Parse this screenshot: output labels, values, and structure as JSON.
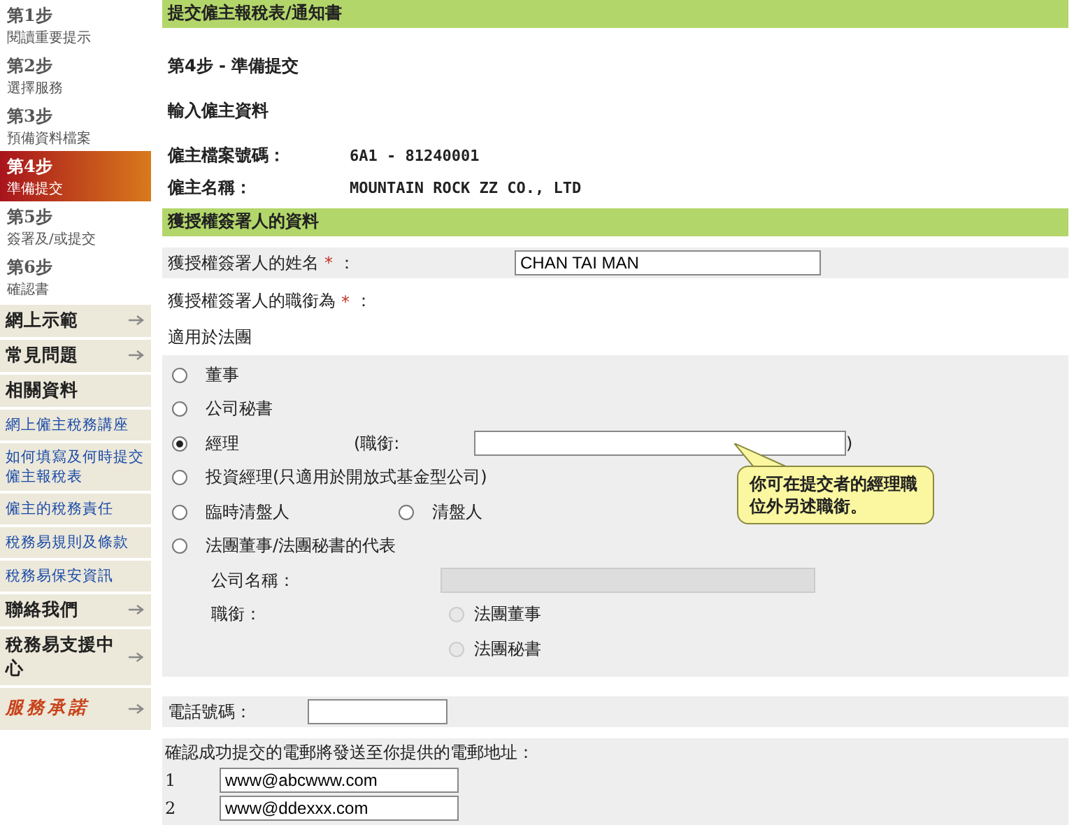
{
  "sidebar": {
    "steps": [
      {
        "step": "第1步",
        "label": "閱讀重要提示",
        "selected": false
      },
      {
        "step": "第2步",
        "label": "選擇服務",
        "selected": false
      },
      {
        "step": "第3步",
        "label": "預備資料檔案",
        "selected": false
      },
      {
        "step": "第4步",
        "label": "準備提交",
        "selected": true
      },
      {
        "step": "第5步",
        "label": "簽署及/或提交",
        "selected": false
      },
      {
        "step": "第6步",
        "label": "確認書",
        "selected": false
      }
    ],
    "menu": [
      {
        "kind": "menu",
        "label": "網上示範"
      },
      {
        "kind": "menu",
        "label": "常見問題"
      },
      {
        "kind": "heading",
        "label": "相關資料"
      },
      {
        "kind": "link",
        "label": "網上僱主稅務講座"
      },
      {
        "kind": "link",
        "label": "如何填寫及何時提交僱主報稅表"
      },
      {
        "kind": "link",
        "label": "僱主的稅務責任"
      },
      {
        "kind": "link",
        "label": "稅務易規則及條款"
      },
      {
        "kind": "link",
        "label": "稅務易保安資訊"
      },
      {
        "kind": "menu",
        "label": "聯絡我們"
      },
      {
        "kind": "menu",
        "label": "稅務易支援中心"
      },
      {
        "kind": "logo",
        "label": "服務承諾"
      }
    ]
  },
  "page_title": "提交僱主報稅表/通知書",
  "step_title": "第4步 - 準備提交",
  "employer_heading": "輸入僱主資料",
  "employer_fields": [
    {
      "label": "僱主檔案號碼：",
      "value": "6A1 - 81240001"
    },
    {
      "label": "僱主名稱：",
      "value": "MOUNTAIN ROCK ZZ CO., LTD"
    }
  ],
  "signer_section": "獲授權簽署人的資料",
  "signer_name": {
    "label": "獲授權簽署人的姓名",
    "required": "*",
    "colon": "：",
    "value": "CHAN TAI MAN"
  },
  "signer_title": {
    "label": "獲授權簽署人的職銜為",
    "required": "*",
    "colon": "："
  },
  "corporation_heading": "適用於法團",
  "options": [
    {
      "kind": "plain",
      "choices": [
        {
          "label": "董事",
          "selected": false
        }
      ]
    },
    {
      "kind": "plain",
      "choices": [
        {
          "label": "公司秘書",
          "selected": false
        }
      ]
    },
    {
      "kind": "title_field",
      "choices": [
        {
          "label": "經理",
          "selected": true
        }
      ],
      "field_label": "(職銜:",
      "field_close": ")"
    },
    {
      "kind": "plain",
      "choices": [
        {
          "label": "投資經理(只適用於開放式基金型公司)",
          "selected": false
        }
      ]
    },
    {
      "kind": "plain",
      "choices": [
        {
          "label": "臨時清盤人",
          "selected": false
        },
        {
          "label": "清盤人",
          "selected": false
        }
      ]
    },
    {
      "kind": "representative",
      "choices": [
        {
          "label": "法團董事/法團秘書的代表",
          "selected": false
        }
      ],
      "company_label": "公司名稱：",
      "title_label": "職銜：",
      "sub_choices": [
        {
          "label": "法團董事",
          "selected": false
        },
        {
          "label": "法團秘書",
          "selected": false
        }
      ]
    }
  ],
  "callout": "你可在提交者的經理職位外另述職銜。",
  "phone": {
    "label": "電話號碼："
  },
  "email": {
    "intro": "確認成功提交的電郵將發送至你提供的電郵地址：",
    "entries": [
      {
        "index": "1",
        "value": "www@abcwww.com"
      },
      {
        "index": "2",
        "value": "www@ddexxx.com"
      }
    ]
  }
}
